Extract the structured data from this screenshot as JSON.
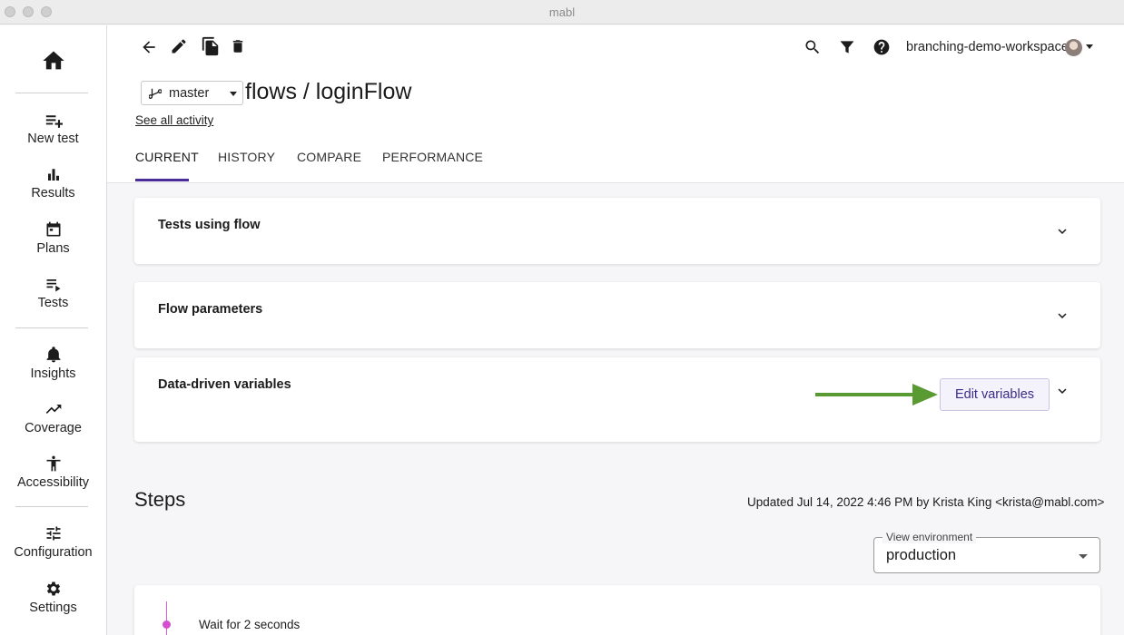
{
  "window": {
    "title": "mabl"
  },
  "sidebar": {
    "items": [
      {
        "label": "New test",
        "icon": "playlist-add-icon"
      },
      {
        "label": "Results",
        "icon": "bar-chart-icon"
      },
      {
        "label": "Plans",
        "icon": "calendar-icon"
      },
      {
        "label": "Tests",
        "icon": "playlist-play-icon"
      },
      {
        "label": "Insights",
        "icon": "bell-icon"
      },
      {
        "label": "Coverage",
        "icon": "trending-up-icon"
      },
      {
        "label": "Accessibility",
        "icon": "accessibility-icon"
      },
      {
        "label": "Configuration",
        "icon": "tune-icon"
      },
      {
        "label": "Settings",
        "icon": "gear-icon"
      }
    ]
  },
  "header": {
    "workspace": "branching-demo-workspace",
    "branch": "master",
    "title": "flows / loginFlow",
    "activity_link": "See all activity",
    "tabs": [
      {
        "label": "CURRENT",
        "active": true
      },
      {
        "label": "HISTORY",
        "active": false
      },
      {
        "label": "COMPARE",
        "active": false
      },
      {
        "label": "PERFORMANCE",
        "active": false
      }
    ]
  },
  "sections": {
    "tests_using_flow": "Tests using flow",
    "flow_parameters": "Flow parameters",
    "data_driven_variables": "Data-driven variables",
    "edit_variables_label": "Edit variables"
  },
  "steps": {
    "heading": "Steps",
    "updated": "Updated Jul 14, 2022 4:46 PM by Krista King <krista@mabl.com>",
    "environment_label": "View environment",
    "environment_value": "production",
    "items": [
      {
        "text": "Wait for 2 seconds"
      }
    ]
  },
  "colors": {
    "accent": "#4a2d9b",
    "annotation_arrow": "#5a9a32",
    "step_marker": "#d34fd0"
  }
}
